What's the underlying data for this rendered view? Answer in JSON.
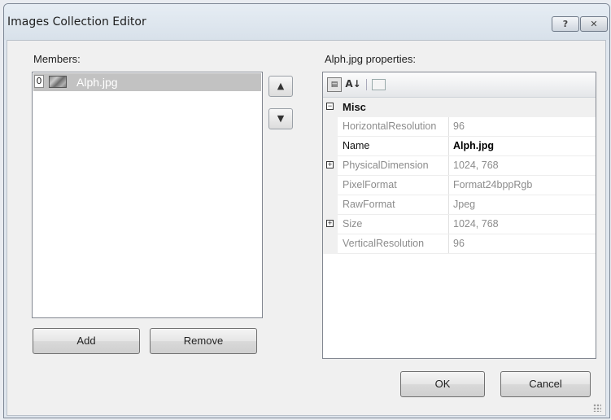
{
  "window": {
    "title": "Images Collection Editor",
    "help_label": "?",
    "close_label": "✕"
  },
  "members": {
    "label": "Members:",
    "items": [
      {
        "index": "0",
        "name": "Alph.jpg",
        "selected": true
      }
    ]
  },
  "buttons": {
    "add": "Add",
    "remove": "Remove",
    "move_up": "▲",
    "move_down": "▼",
    "ok": "OK",
    "cancel": "Cancel"
  },
  "properties": {
    "label": "Alph.jpg properties:",
    "toolbar": {
      "categorized_icon": "categorized-icon",
      "alphabetical_icon": "alphabetical-icon",
      "alphabetical_glyph": "A↓",
      "property_pages_icon": "property-pages-icon"
    },
    "category": "Misc",
    "rows": [
      {
        "name": "HorizontalResolution",
        "value": "96",
        "expandable": false,
        "active": false
      },
      {
        "name": "Name",
        "value": "Alph.jpg",
        "expandable": false,
        "active": true
      },
      {
        "name": "PhysicalDimension",
        "value": "1024, 768",
        "expandable": true,
        "active": false
      },
      {
        "name": "PixelFormat",
        "value": "Format24bppRgb",
        "expandable": false,
        "active": false
      },
      {
        "name": "RawFormat",
        "value": "Jpeg",
        "expandable": false,
        "active": false
      },
      {
        "name": "Size",
        "value": "1024, 768",
        "expandable": true,
        "active": false
      },
      {
        "name": "VerticalResolution",
        "value": "96",
        "expandable": false,
        "active": false
      }
    ]
  },
  "colors": {
    "selection": "#c2c2c2",
    "window_frame": "#dfe6ee",
    "client_bg": "#f0f0f0"
  }
}
